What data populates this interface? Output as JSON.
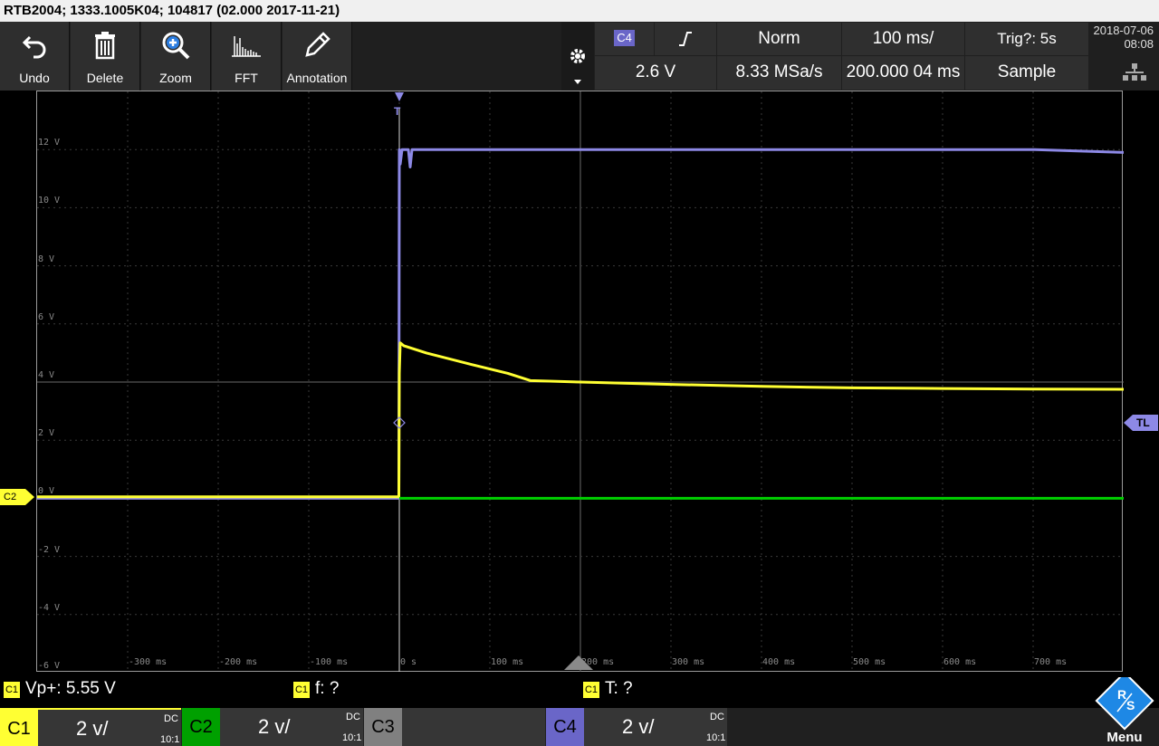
{
  "title": "RTB2004; 1333.1005K04; 104817 (02.000 2017-11-21)",
  "toolbar": {
    "undo": "Undo",
    "delete": "Delete",
    "zoom": "Zoom",
    "fft": "FFT",
    "annotation": "Annotation"
  },
  "acquisition": {
    "trigger_source": "C4",
    "trigger_mode": "Norm",
    "time_scale": "100 ms/",
    "trigger_status": "Trig?: 5s",
    "trigger_level": "2.6 V",
    "sample_rate": "8.33 MSa/s",
    "position": "200.000 04 ms",
    "acq_mode": "Sample"
  },
  "datetime": {
    "date": "2018-07-06",
    "time": "08:08"
  },
  "markers": {
    "trigger_level": "TL",
    "ground_channel": "C2"
  },
  "measurements": [
    {
      "src": "C1",
      "text": "Vp+: 5.55 V"
    },
    {
      "src": "C1",
      "text": "f: ?"
    },
    {
      "src": "C1",
      "text": "T: ?"
    }
  ],
  "channels": [
    {
      "name": "C1",
      "scale": "2 v/",
      "coupling": "DC",
      "probe": "10:1",
      "color": "#ffff33"
    },
    {
      "name": "C2",
      "scale": "2 v/",
      "coupling": "DC",
      "probe": "10:1",
      "color": "#00a000"
    },
    {
      "name": "C3",
      "scale": "",
      "coupling": "",
      "probe": "",
      "color": "#808080"
    },
    {
      "name": "C4",
      "scale": "2 v/",
      "coupling": "DC",
      "probe": "10:1",
      "color": "#7a70c8"
    }
  ],
  "chart_data": {
    "type": "line",
    "xlabel": "",
    "ylabel": "",
    "x_unit": "ms",
    "y_unit": "V",
    "xlim": [
      -400,
      800
    ],
    "ylim": [
      -6,
      14
    ],
    "y_ticks": [
      "12 V",
      "10 V",
      "8 V",
      "6 V",
      "4 V",
      "2 V",
      "0 V",
      "-2 V",
      "-4 V",
      "-6 V"
    ],
    "x_ticks": [
      "-300 ms",
      "-200 ms",
      "-100 ms",
      "0 s",
      "100 ms",
      "200 ms",
      "300 ms",
      "400 ms",
      "500 ms",
      "600 ms",
      "700 ms"
    ],
    "grid": true,
    "series": [
      {
        "name": "C4",
        "color": "#8d89e6",
        "x": [
          -400,
          -0.5,
          0,
          1,
          3,
          10,
          12,
          14,
          18,
          100,
          300,
          500,
          700,
          800
        ],
        "y": [
          0,
          0,
          12,
          11.5,
          12,
          12,
          11.4,
          12,
          12,
          12,
          12,
          12,
          12,
          11.9
        ]
      },
      {
        "name": "C1",
        "color": "#ffff33",
        "x": [
          -400,
          -0.5,
          0,
          1,
          5,
          30,
          80,
          120,
          145,
          200,
          300,
          400,
          500,
          600,
          700,
          800
        ],
        "y": [
          0.05,
          0.05,
          4.3,
          5.35,
          5.25,
          5.0,
          4.6,
          4.3,
          4.05,
          4.0,
          3.92,
          3.85,
          3.8,
          3.78,
          3.76,
          3.75
        ]
      },
      {
        "name": "C2",
        "color": "#00d000",
        "x": [
          0,
          200,
          400,
          600,
          800
        ],
        "y": [
          0,
          0,
          0,
          0,
          0
        ]
      }
    ]
  }
}
